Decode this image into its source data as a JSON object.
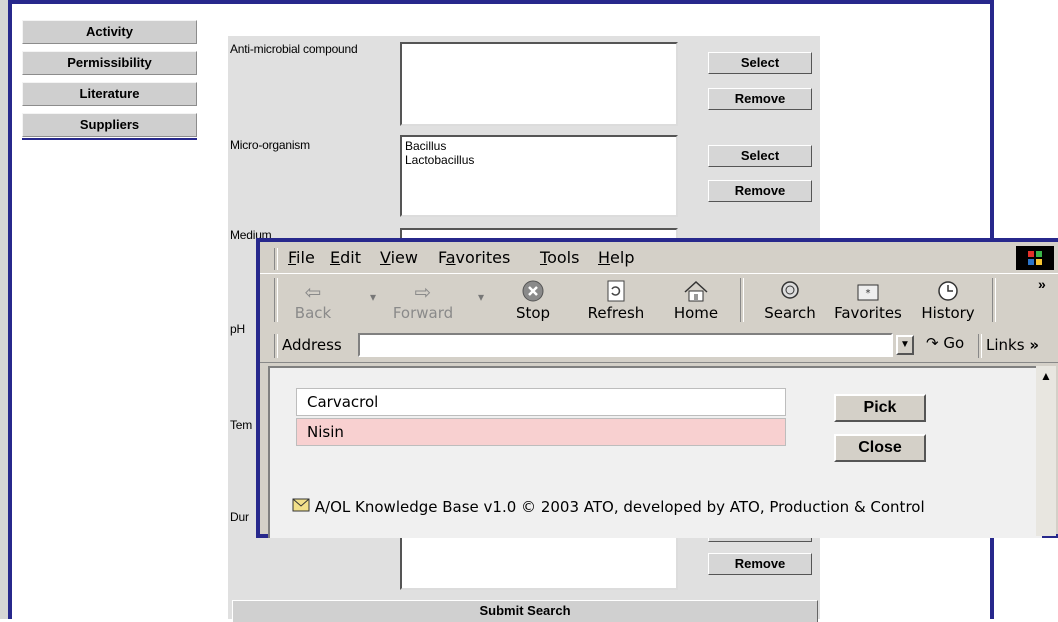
{
  "sidebar": {
    "items": [
      {
        "label": "Activity"
      },
      {
        "label": "Permissibility"
      },
      {
        "label": "Literature"
      },
      {
        "label": "Suppliers"
      }
    ]
  },
  "form": {
    "fields": [
      {
        "label": "Anti-microbial compound",
        "values": [],
        "select_label": "Select",
        "remove_label": "Remove"
      },
      {
        "label": "Micro-organism",
        "values": [
          "Bacillus",
          "Lactobacillus"
        ],
        "select_label": "Select",
        "remove_label": "Remove"
      },
      {
        "label": "Medium"
      },
      {
        "label": "pH"
      },
      {
        "label": "Tem"
      },
      {
        "label": "Dur",
        "remove_label": "Remove"
      }
    ],
    "submit_label": "Submit Search"
  },
  "popup": {
    "menu": [
      "File",
      "Edit",
      "View",
      "Favorites",
      "Tools",
      "Help"
    ],
    "toolbar": [
      {
        "label": "Back",
        "icon": "back-arrow-icon",
        "disabled": true
      },
      {
        "label": "Forward",
        "icon": "forward-arrow-icon",
        "disabled": true
      },
      {
        "label": "Stop",
        "icon": "stop-icon"
      },
      {
        "label": "Refresh",
        "icon": "refresh-icon"
      },
      {
        "label": "Home",
        "icon": "home-icon"
      },
      {
        "label": "Search",
        "icon": "search-icon"
      },
      {
        "label": "Favorites",
        "icon": "favorites-icon"
      },
      {
        "label": "History",
        "icon": "history-icon"
      }
    ],
    "address_label": "Address",
    "address_value": "",
    "go_label": "Go",
    "links_label": "Links",
    "chevron": "»",
    "options": [
      {
        "label": "Carvacrol",
        "selected": false
      },
      {
        "label": "Nisin",
        "selected": true
      }
    ],
    "pick_label": "Pick",
    "close_label": "Close",
    "status_text": "A/OL Knowledge Base v1.0 © 2003 ATO, developed by ATO, Production & Control"
  },
  "colors": {
    "frame": "#27288c",
    "selected_row": "#f8d0d0"
  }
}
